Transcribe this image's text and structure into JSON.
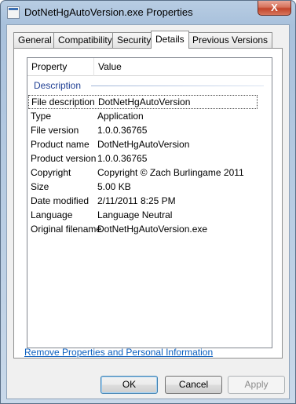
{
  "window": {
    "title": "DotNetHgAutoVersion.exe Properties",
    "close_glyph": "X"
  },
  "tabs": [
    {
      "label": "General"
    },
    {
      "label": "Compatibility"
    },
    {
      "label": "Security"
    },
    {
      "label": "Details"
    },
    {
      "label": "Previous Versions"
    }
  ],
  "active_tab": "Details",
  "listview": {
    "columns": {
      "property": "Property",
      "value": "Value"
    },
    "group": "Description",
    "rows": [
      {
        "property": "File description",
        "value": "DotNetHgAutoVersion"
      },
      {
        "property": "Type",
        "value": "Application"
      },
      {
        "property": "File version",
        "value": "1.0.0.36765"
      },
      {
        "property": "Product name",
        "value": "DotNetHgAutoVersion"
      },
      {
        "property": "Product version",
        "value": "1.0.0.36765"
      },
      {
        "property": "Copyright",
        "value": "Copyright © Zach Burlingame 2011"
      },
      {
        "property": "Size",
        "value": "5.00 KB"
      },
      {
        "property": "Date modified",
        "value": "2/11/2011 8:25 PM"
      },
      {
        "property": "Language",
        "value": "Language Neutral"
      },
      {
        "property": "Original filename",
        "value": "DotNetHgAutoVersion.exe"
      }
    ]
  },
  "link": {
    "label": "Remove Properties and Personal Information"
  },
  "buttons": {
    "ok": "OK",
    "cancel": "Cancel",
    "apply": "Apply"
  }
}
